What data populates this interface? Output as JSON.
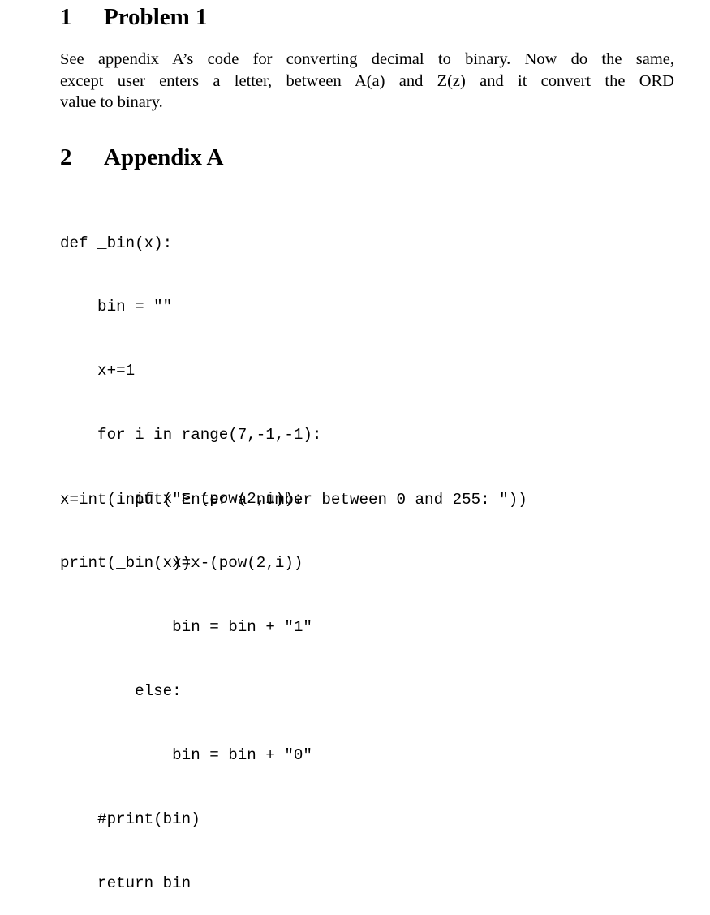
{
  "sections": [
    {
      "number": "1",
      "title": "Problem 1",
      "paragraph_lines": [
        "See appendix A’s code for converting decimal to binary.  Now do the same,",
        "except user enters a letter, between A(a) and Z(z) and it convert the ORD",
        "value to binary."
      ]
    },
    {
      "number": "2",
      "title": "Appendix A",
      "code_function": [
        "def _bin(x):",
        "    bin = \"\"",
        "    x+=1",
        "    for i in range(7,-1,-1):",
        "        if x > (pow(2,i)):",
        "            x=x-(pow(2,i))",
        "            bin = bin + \"1\"",
        "        else:",
        "            bin = bin + \"0\"",
        "    #print(bin)",
        "    return bin"
      ],
      "code_main": [
        "x=int(input(\"Enter a number between 0 and 255: \"))",
        "print(_bin(x))"
      ]
    }
  ]
}
